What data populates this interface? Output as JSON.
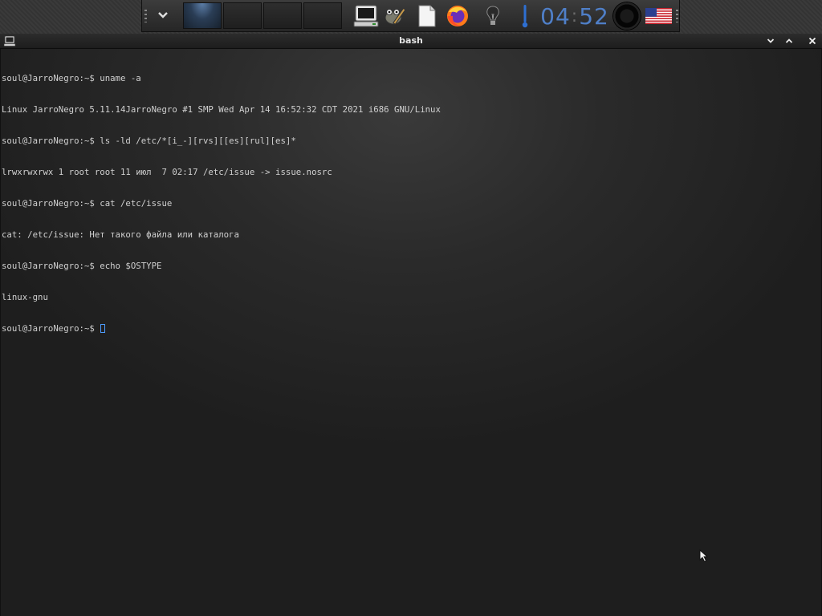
{
  "panel": {
    "workspaces": [
      "workspace-1",
      "workspace-2",
      "workspace-3",
      "workspace-4"
    ],
    "active_workspace": 1,
    "clock": {
      "hours": "04",
      "minutes": "52"
    },
    "launchers": [
      "terminal-icon",
      "gimp-icon",
      "text-editor-icon",
      "firefox-icon",
      "lightbulb-icon",
      "thermometer-icon"
    ]
  },
  "window": {
    "title": "bash"
  },
  "terminal": {
    "lines": [
      "soul@JarroNegro:~$ uname -a",
      "Linux JarroNegro 5.11.14JarroNegro #1 SMP Wed Apr 14 16:52:32 CDT 2021 i686 GNU/Linux",
      "soul@JarroNegro:~$ ls -ld /etc/*[i_-][rvs][[es][rul][es]*",
      "lrwxrwxrwx 1 root root 11 июл  7 02:17 /etc/issue -> issue.nosrc",
      "soul@JarroNegro:~$ cat /etc/issue",
      "cat: /etc/issue: Нет такого файла или каталога",
      "soul@JarroNegro:~$ echo $OSTYPE",
      "linux-gnu"
    ],
    "prompt": "soul@JarroNegro:~$ "
  },
  "colors": {
    "clock": "#4f7fc8",
    "cursor": "#4d9cff",
    "terminal_text": "#d0d0d0"
  }
}
